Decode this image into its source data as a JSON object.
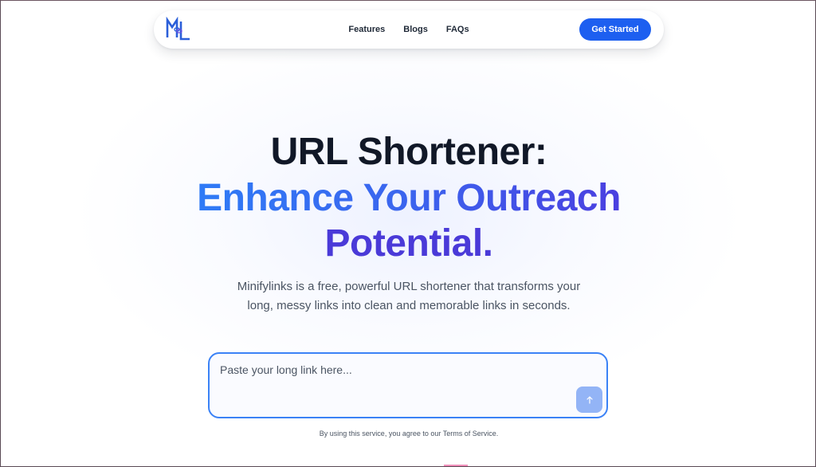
{
  "brand": {
    "logo_letters": "ML",
    "accent_color": "#1d5ff0"
  },
  "nav": {
    "links": [
      {
        "label": "Features"
      },
      {
        "label": "Blogs"
      },
      {
        "label": "FAQs"
      }
    ],
    "cta_label": "Get Started"
  },
  "hero": {
    "title_line1": "URL Shortener:",
    "title_line2": "Enhance Your Outreach",
    "title_line3": "Potential.",
    "subtitle_line1": "Minifylinks is a free, powerful URL shortener that transforms your",
    "subtitle_line2": "long, messy links into clean and memorable links in seconds.",
    "gradient_colors": [
      "#2f7bf6",
      "#4a3fe0"
    ]
  },
  "shortener": {
    "input_placeholder": "Paste your long link here...",
    "input_value": "",
    "submit_icon": "arrow-up-icon",
    "terms_text": "By using this service, you agree to our Terms of Service."
  }
}
